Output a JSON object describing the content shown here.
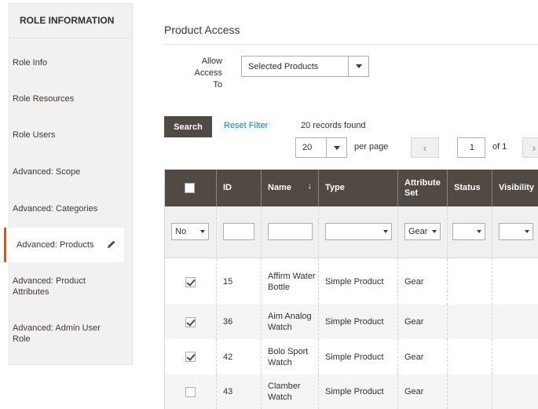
{
  "sidebar": {
    "title": "ROLE INFORMATION",
    "items": [
      {
        "label": "Role Info"
      },
      {
        "label": "Role Resources"
      },
      {
        "label": "Role Users"
      },
      {
        "label": "Advanced: Scope"
      },
      {
        "label": "Advanced: Categories"
      },
      {
        "label": "Advanced: Products",
        "active": true
      },
      {
        "label": "Advanced: Product Attributes"
      },
      {
        "label": "Advanced: Admin User Role"
      }
    ]
  },
  "main": {
    "section_title": "Product Access",
    "allow_access_label": "Allow Access To",
    "allow_access_value": "Selected Products",
    "search_button": "Search",
    "reset_filter": "Reset Filter",
    "records_found": "20 records found",
    "per_page_value": "20",
    "per_page_label": "per page",
    "page_prev": "‹",
    "page_next": "›",
    "page_current": "1",
    "page_of": "of 1"
  },
  "grid": {
    "columns": [
      "",
      "ID",
      "Name",
      "Type",
      "Attribute Set",
      "Status",
      "Visibility"
    ],
    "filters": {
      "selected": "No",
      "attribute_set": "Gear"
    },
    "rows": [
      {
        "checked": true,
        "id": "15",
        "name": "Affirm Water Bottle",
        "type": "Simple Product",
        "attribute_set": "Gear",
        "status": "",
        "visibility": ""
      },
      {
        "checked": true,
        "id": "36",
        "name": "Aim Analog Watch",
        "type": "Simple Product",
        "attribute_set": "Gear",
        "status": "",
        "visibility": ""
      },
      {
        "checked": true,
        "id": "42",
        "name": "Bolo Sport Watch",
        "type": "Simple Product",
        "attribute_set": "Gear",
        "status": "",
        "visibility": ""
      },
      {
        "checked": false,
        "id": "43",
        "name": "Clamber Watch",
        "type": "Simple Product",
        "attribute_set": "Gear",
        "status": "",
        "visibility": ""
      }
    ]
  },
  "colors": {
    "active_accent": "#eb5202",
    "header_bg": "#514943",
    "link": "#007bdb"
  }
}
